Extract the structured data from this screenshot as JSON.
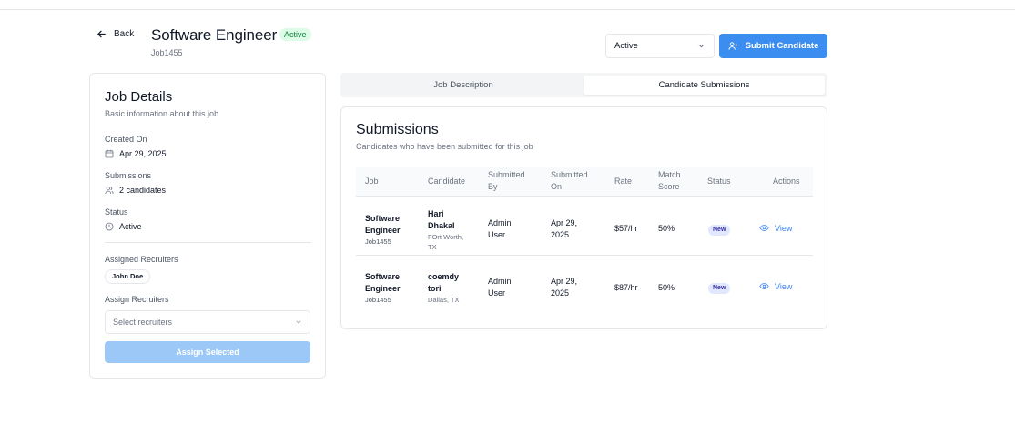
{
  "header": {
    "back_label": "Back",
    "title": "Software Engineer",
    "status_badge": "Active",
    "job_id": "Job1455",
    "status_select_value": "Active",
    "submit_label": "Submit Candidate"
  },
  "details": {
    "title": "Job Details",
    "subtitle": "Basic information about this job",
    "created_label": "Created On",
    "created_value": "Apr 29, 2025",
    "submissions_label": "Submissions",
    "submissions_value": "2 candidates",
    "status_label": "Status",
    "status_value": "Active",
    "assigned_label": "Assigned Recruiters",
    "assigned_recruiters": [
      "John Doe"
    ],
    "assign_label": "Assign Recruiters",
    "assign_placeholder": "Select recruiters",
    "assign_button": "Assign Selected"
  },
  "tabs": [
    {
      "label": "Job Description",
      "active": false
    },
    {
      "label": "Candidate Submissions",
      "active": true
    }
  ],
  "submissions": {
    "title": "Submissions",
    "subtitle": "Candidates who have been submitted for this job",
    "columns": [
      "Job",
      "Candidate",
      "Submitted By",
      "Submitted On",
      "Rate",
      "Match Score",
      "Status",
      "Actions"
    ],
    "rows": [
      {
        "job_line1": "Software",
        "job_line2": "Engineer",
        "job_id": "Job1455",
        "candidate_line1": "Hari",
        "candidate_line2": "Dhakal",
        "location_line1": "FOrt Worth,",
        "location_line2": "TX",
        "submitted_by_line1": "Admin",
        "submitted_by_line2": "User",
        "submitted_on_line1": "Apr 29,",
        "submitted_on_line2": "2025",
        "rate": "$57/hr",
        "match": "50%",
        "status": "New",
        "action": "View"
      },
      {
        "job_line1": "Software",
        "job_line2": "Engineer",
        "job_id": "Job1455",
        "candidate_line1": "coemdy",
        "candidate_line2": "tori",
        "location_line1": "Dallas, TX",
        "location_line2": "",
        "submitted_by_line1": "Admin",
        "submitted_by_line2": "User",
        "submitted_on_line1": "Apr 29,",
        "submitted_on_line2": "2025",
        "rate": "$87/hr",
        "match": "50%",
        "status": "New",
        "action": "View"
      }
    ]
  },
  "colors": {
    "accent": "#3b8ef0",
    "active_badge_bg": "#dcfce7",
    "active_badge_text": "#15803d",
    "new_badge_bg": "#e0e7ff",
    "assign_disabled": "#9cc8f7"
  }
}
